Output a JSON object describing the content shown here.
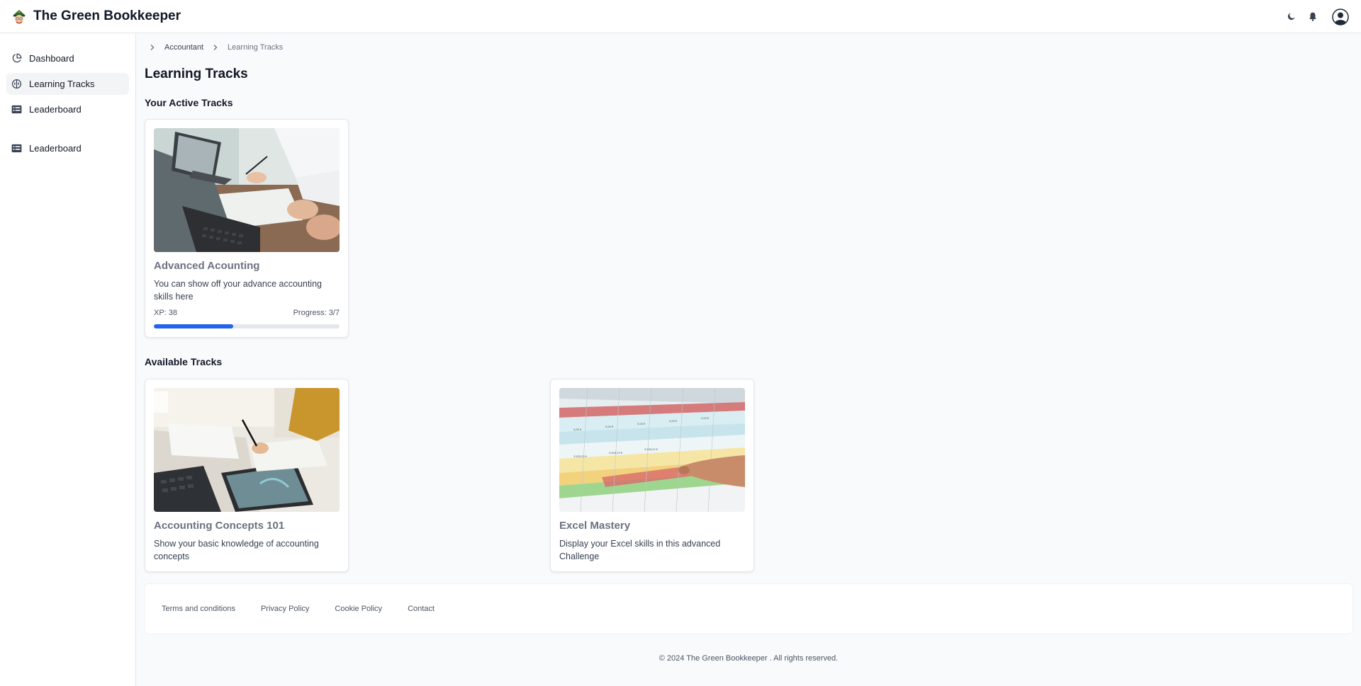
{
  "app": {
    "name": "The Green Bookkeeper"
  },
  "header": {
    "icons": [
      "moon-icon",
      "bell-icon",
      "user-avatar-icon"
    ]
  },
  "sidebar": {
    "items": [
      {
        "label": "Dashboard",
        "icon": "pie-chart-icon",
        "active": false
      },
      {
        "label": "Learning Tracks",
        "icon": "brain-icon",
        "active": true
      },
      {
        "label": "Leaderboard",
        "icon": "list-icon",
        "active": false
      },
      {
        "label": "Leaderboard",
        "icon": "list-icon",
        "active": false
      }
    ]
  },
  "breadcrumb": {
    "items": [
      "Accountant",
      "Learning Tracks"
    ]
  },
  "page": {
    "title": "Learning Tracks",
    "active_section_title": "Your Active Tracks",
    "available_section_title": "Available Tracks"
  },
  "active_tracks": [
    {
      "title": "Advanced Acounting",
      "description": "You can show off your advance accounting skills here",
      "xp_label": "XP: 38",
      "progress_label": "Progress: 3/7",
      "progress_completed": 3,
      "progress_total": 7
    }
  ],
  "available_tracks": [
    {
      "title": "Accounting Concepts 101",
      "description": "Show your basic knowledge of accounting concepts"
    },
    {
      "title": "Excel Mastery",
      "description": "Display your Excel skills in this advanced Challenge"
    }
  ],
  "footer": {
    "links": [
      "Terms and conditions",
      "Privacy Policy",
      "Cookie Policy",
      "Contact"
    ],
    "copyright": "© 2024 The Green Bookkeeper . All rights reserved."
  },
  "colors": {
    "accent": "#2563eb",
    "background": "#f9fafb"
  }
}
